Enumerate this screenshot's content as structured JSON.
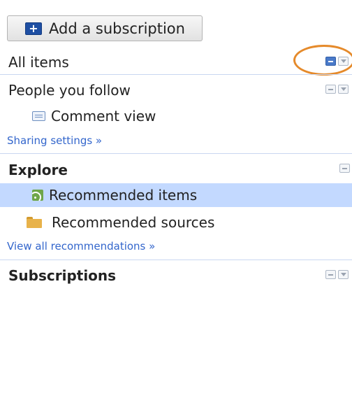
{
  "add_button": {
    "label": "Add a subscription"
  },
  "nav": {
    "all_items": "All items",
    "people_you_follow": "People you follow",
    "comment_view": "Comment view",
    "sharing_settings": "Sharing settings »"
  },
  "explore": {
    "heading": "Explore",
    "recommended_items": "Recommended items",
    "recommended_sources": "Recommended sources",
    "view_all": "View all recommendations »"
  },
  "subscriptions": {
    "heading": "Subscriptions"
  },
  "colors": {
    "highlight": "#c3d9ff",
    "link": "#3366cc",
    "annotation": "#e58a2b"
  }
}
